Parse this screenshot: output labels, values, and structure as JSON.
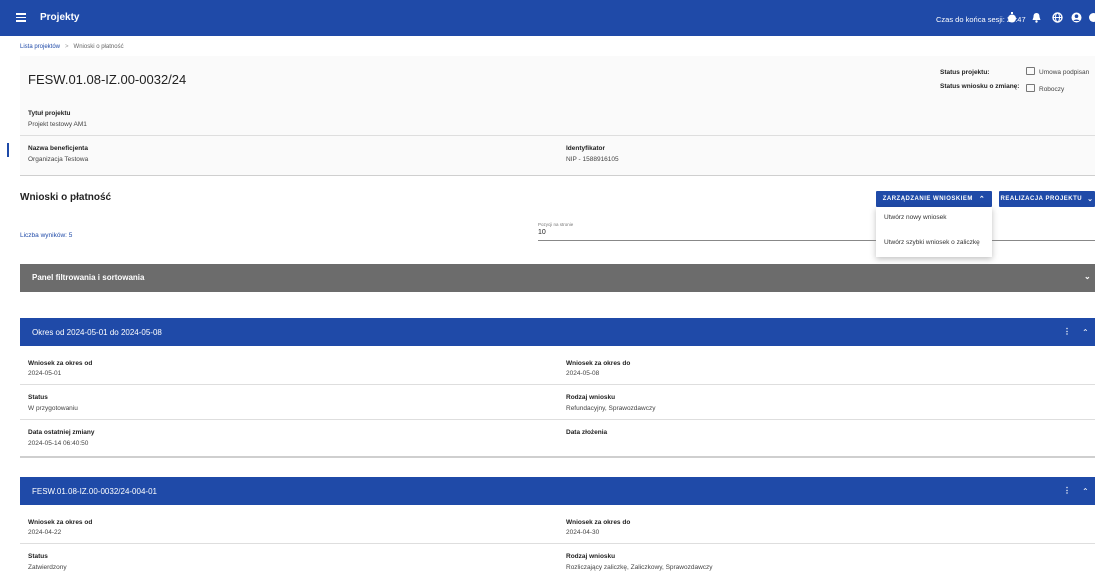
{
  "topbar": {
    "title": "Projekty",
    "session": "Czas do końca sesji: 25:47",
    "icons": [
      "menu-icon",
      "timer-icon",
      "bell-icon",
      "globe-icon",
      "user-icon",
      "power-icon"
    ]
  },
  "breadcrumb": {
    "root": "Lista projektów",
    "sep": ">",
    "current": "Wnioski o płatność"
  },
  "project": {
    "id": "FESW.01.08-IZ.00-0032/24",
    "status_label": "Status projektu:",
    "status_value": "Umowa podpisan",
    "change_label": "Status wniosku o zmianę:",
    "change_value": "Roboczy",
    "title_label": "Tytuł projektu",
    "title_value": "Projekt testowy AM1",
    "beneficiary_label": "Nazwa beneficjenta",
    "beneficiary_value": "Organizacja Testowa",
    "identifier_label": "Identyfikator",
    "identifier_value": "NIP - 1588916105"
  },
  "section": {
    "title": "Wnioski o płatność",
    "btn_manage": "ZARZĄDZANIE WNIOSKIEM",
    "btn_realization": "REALIZACJA PROJEKTU",
    "menu_items": [
      "Utwórz nowy wniosek",
      "Utwórz szybki wniosek o zaliczkę"
    ],
    "results": "Liczba wyników: 5",
    "per_page_label": "Pozycji na stronie",
    "per_page_value": "10",
    "filter_panel": "Panel filtrowania i sortowania"
  },
  "cards": [
    {
      "title": "Okres od 2024-05-01 do 2024-05-08",
      "from_label": "Wniosek za okres od",
      "from_value": "2024-05-01",
      "to_label": "Wniosek za okres do",
      "to_value": "2024-05-08",
      "status_label": "Status",
      "status_value": "W przygotowaniu",
      "type_label": "Rodzaj wniosku",
      "type_value": "Refundacyjny, Sprawozdawczy",
      "changed_label": "Data ostatniej zmiany",
      "changed_value": "2024-05-14 06:40:50",
      "submitted_label": "Data złożenia"
    },
    {
      "title": "FESW.01.08-IZ.00-0032/24-004-01",
      "from_label": "Wniosek za okres od",
      "from_value": "2024-04-22",
      "to_label": "Wniosek za okres do",
      "to_value": "2024-04-30",
      "status_label": "Status",
      "status_value": "Zatwierdzony",
      "type_label": "Rodzaj wniosku",
      "type_value": "Rozliczający zaliczkę, Zaliczkowy, Sprawozdawczy"
    }
  ]
}
